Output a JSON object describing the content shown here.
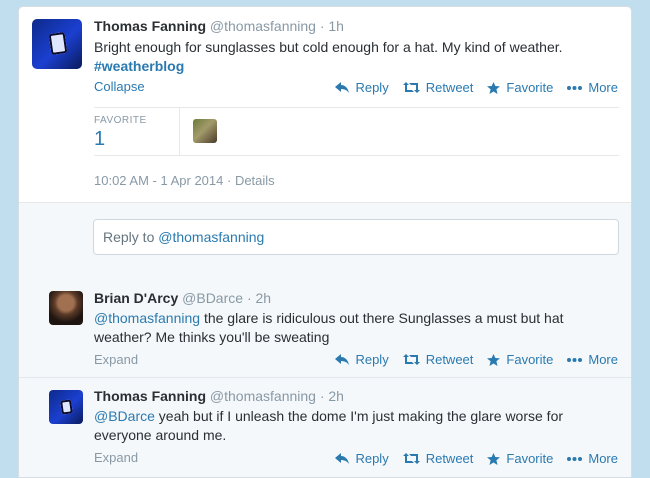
{
  "main_tweet": {
    "author_name": "Thomas Fanning",
    "author_handle": "@thomasfanning",
    "time_ago": "· 1h",
    "text": "Bright enough for sunglasses but cold enough for a hat. My kind of weather.",
    "hashtag": "#weatherblog",
    "collapse_label": "Collapse",
    "favorite_label": "FAVORITE",
    "favorite_count": "1",
    "timestamp": "10:02 AM - 1 Apr 2014",
    "details_label": "· Details"
  },
  "actions": {
    "reply": "Reply",
    "retweet": "Retweet",
    "favorite": "Favorite",
    "more": "More"
  },
  "reply_box": {
    "prefix": "Reply to ",
    "mention": "@thomasfanning"
  },
  "replies": [
    {
      "author_name": "Brian D'Arcy",
      "author_handle": "@BDarce",
      "time_ago": "· 2h",
      "mention": "@thomasfanning",
      "text_line1": " the glare is ridiculous out there Sunglasses a must but hat",
      "text_line2": "weather? Me thinks you'll be sweating",
      "expand_label": "Expand"
    },
    {
      "author_name": "Thomas Fanning",
      "author_handle": "@thomasfanning",
      "time_ago": "· 2h",
      "mention": "@BDarce",
      "text_line1": " yeah but if I unleash the dome I'm just making the glare worse for",
      "text_line2": "everyone around me.",
      "expand_label": "Expand"
    }
  ],
  "colors": {
    "background": "#c0deed",
    "link": "#2a7ab0",
    "muted": "#8899a6"
  }
}
